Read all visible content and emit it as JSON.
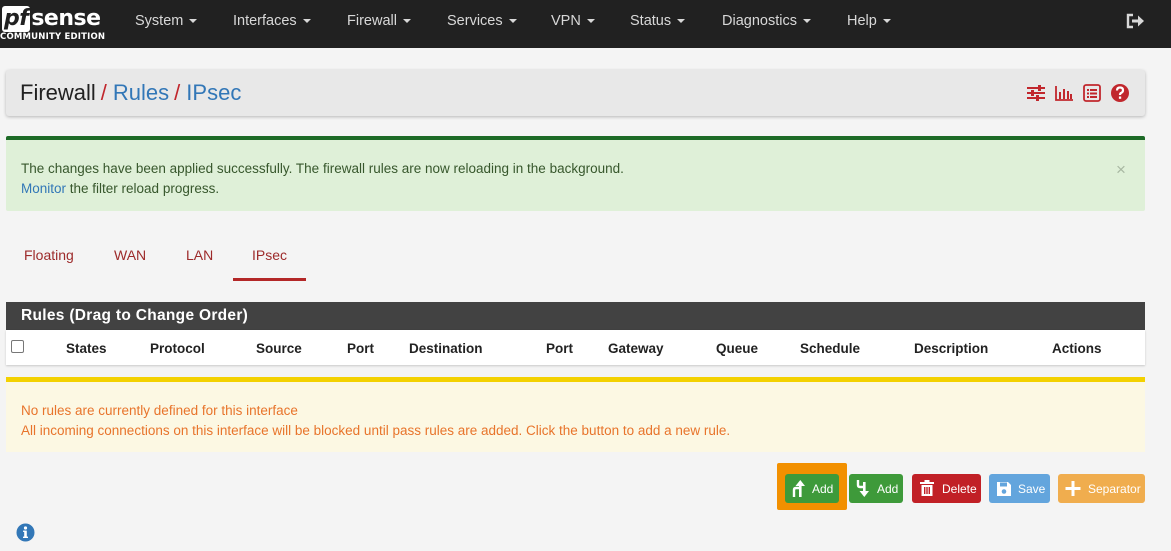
{
  "navbar": {
    "logo_mark": "pf",
    "logo_text": "sense",
    "logo_sub": "COMMUNITY EDITION",
    "menu": [
      "System",
      "Interfaces",
      "Firewall",
      "Services",
      "VPN",
      "Status",
      "Diagnostics",
      "Help"
    ],
    "logout_icon": "sign-out-icon"
  },
  "breadcrumb": {
    "root": "Firewall",
    "sep1": "/",
    "item2": "Rules",
    "sep2": "/",
    "item3": "IPsec",
    "icons": [
      "sliders-icon",
      "bar-chart-icon",
      "list-icon",
      "help-question-icon"
    ]
  },
  "success_alert": {
    "line1": "The changes have been applied successfully. The firewall rules are now reloading in the background.",
    "link": "Monitor",
    "line2_rest": " the filter reload progress.",
    "close": "×"
  },
  "tabs": [
    "Floating",
    "WAN",
    "LAN",
    "IPsec"
  ],
  "active_tab": "IPsec",
  "rules_table": {
    "title": "Rules (Drag to Change Order)",
    "columns": [
      "States",
      "Protocol",
      "Source",
      "Port",
      "Destination",
      "Port",
      "Gateway",
      "Queue",
      "Schedule",
      "Description",
      "Actions"
    ]
  },
  "warning_alert": {
    "line1": "No rules are currently defined for this interface",
    "line2": "All incoming connections on this interface will be blocked until pass rules are added. Click the button to add a new rule."
  },
  "buttons": {
    "add_top": "Add",
    "add_bottom": "Add",
    "delete": "Delete",
    "save": "Save",
    "separator": "Separator"
  },
  "colors": {
    "navbar": "#212121",
    "success_border": "#1d6a26",
    "warning_border": "#f3d100",
    "active_tab": "#b32727",
    "highlight": "#f29000",
    "btn_green": "#3e9a3a",
    "btn_red": "#c12026",
    "btn_blue": "#63a5dd",
    "btn_orange": "#f0ad4e"
  }
}
